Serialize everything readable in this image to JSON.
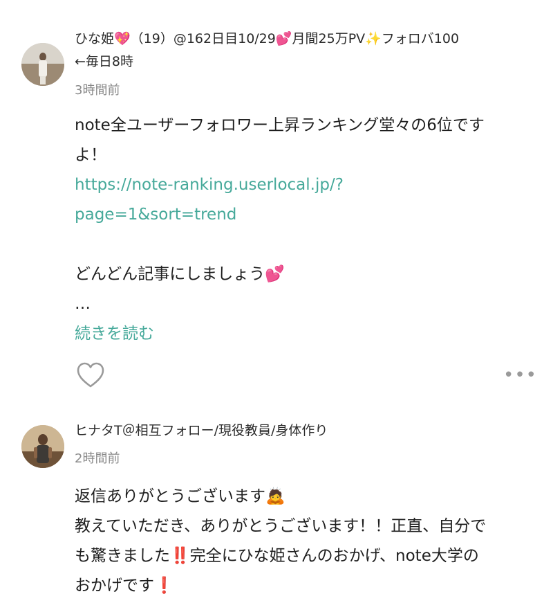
{
  "post1": {
    "author_name": "ひな姫💖（19）@162日目10/29💕月間25万PV✨フォロバ100",
    "author_name_line2": "←毎日8時",
    "time": "3時間前",
    "body_line1": "note全ユーザーフォロワー上昇ランキング堂々の6位です",
    "body_line2": "よ！",
    "link_line1": "https://note-ranking.userlocal.jp/?",
    "link_line2": "page=1&sort=trend",
    "body_line3": "どんどん記事にしましょう💕",
    "ellipsis": "…",
    "read_more": "続きを読む",
    "more_dots": "•••"
  },
  "post2": {
    "author_name": "ヒナタT＠相互フォロー/現役教員/身体作り",
    "time": "2時間前",
    "body_line1": "返信ありがとうございます🙇",
    "body_line2": "教えていただき、ありがとうございます！！正直、自分で",
    "body_line3": "も驚きました‼️完全にひな姫さんのおかげ、note大学の",
    "body_line4": "おかげです❗"
  },
  "icons": {
    "like": "heart-outline-icon",
    "more": "more-dots-icon"
  },
  "colors": {
    "link": "#46a99a",
    "secondary_text": "#8a8a8a",
    "icon": "#9a9a9a"
  }
}
